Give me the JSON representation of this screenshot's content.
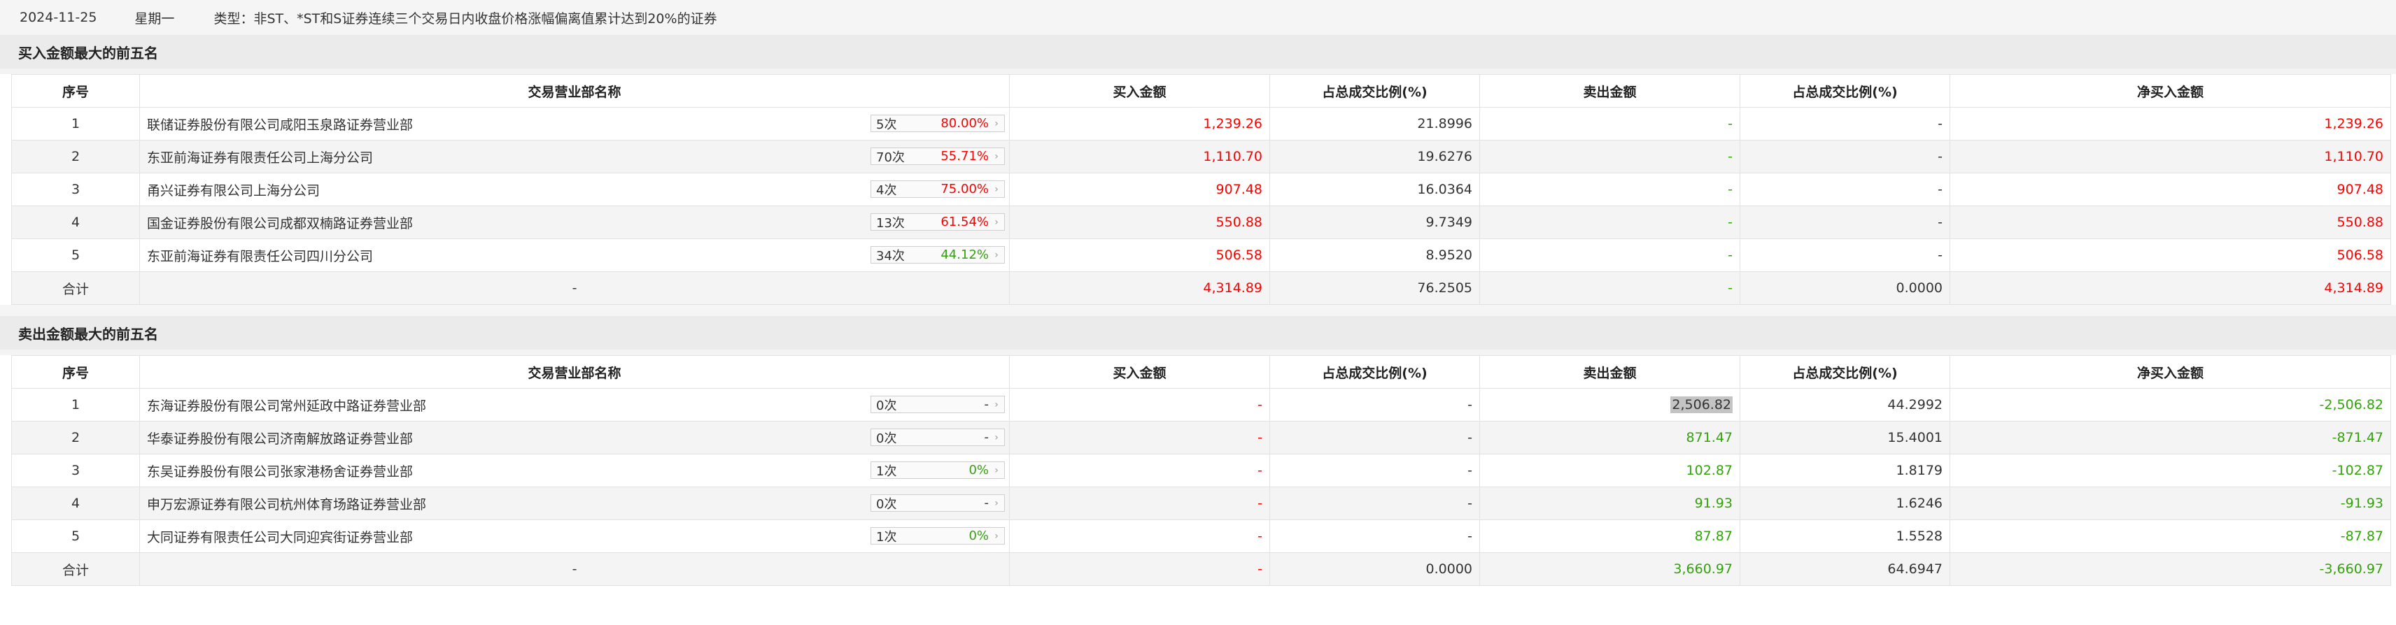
{
  "header": {
    "date": "2024-11-25",
    "weekday": "星期一",
    "type_text": "类型：非ST、*ST和S证券连续三个交易日内收盘价格涨幅偏离值累计达到20%的证券"
  },
  "columns": [
    "序号",
    "交易营业部名称",
    "买入金额",
    "占总成交比例(%)",
    "卖出金额",
    "占总成交比例(%)",
    "净买入金额"
  ],
  "colors": {
    "up": "#ff0000",
    "down": "#33a30b"
  },
  "buy_section": {
    "title": "买入金额最大的前五名",
    "rows": [
      {
        "idx": "1",
        "name": "联储证券股份有限公司咸阳玉泉路证券营业部",
        "count": "5次",
        "rate": "80.00%",
        "buy": "1,239.26",
        "buy_pct": "21.8996",
        "sell": "-",
        "sell_pct": "-",
        "net": "1,239.26"
      },
      {
        "idx": "2",
        "name": "东亚前海证券有限责任公司上海分公司",
        "count": "70次",
        "rate": "55.71%",
        "buy": "1,110.70",
        "buy_pct": "19.6276",
        "sell": "-",
        "sell_pct": "-",
        "net": "1,110.70"
      },
      {
        "idx": "3",
        "name": "甬兴证券有限公司上海分公司",
        "count": "4次",
        "rate": "75.00%",
        "buy": "907.48",
        "buy_pct": "16.0364",
        "sell": "-",
        "sell_pct": "-",
        "net": "907.48"
      },
      {
        "idx": "4",
        "name": "国金证券股份有限公司成都双楠路证券营业部",
        "count": "13次",
        "rate": "61.54%",
        "buy": "550.88",
        "buy_pct": "9.7349",
        "sell": "-",
        "sell_pct": "-",
        "net": "550.88"
      },
      {
        "idx": "5",
        "name": "东亚前海证券有限责任公司四川分公司",
        "count": "34次",
        "rate": "44.12%",
        "buy": "506.58",
        "buy_pct": "8.9520",
        "sell": "-",
        "sell_pct": "-",
        "net": "506.58"
      }
    ],
    "total": {
      "label": "合计",
      "name": "-",
      "buy": "4,314.89",
      "buy_pct": "76.2505",
      "sell": "-",
      "sell_pct": "0.0000",
      "net": "4,314.89"
    }
  },
  "sell_section": {
    "title": "卖出金额最大的前五名",
    "rows": [
      {
        "idx": "1",
        "name": "东海证券股份有限公司常州延政中路证券营业部",
        "count": "0次",
        "rate": "-",
        "buy": "-",
        "buy_pct": "-",
        "sell": "2,506.82",
        "sell_pct": "44.2992",
        "net": "-2,506.82"
      },
      {
        "idx": "2",
        "name": "华泰证券股份有限公司济南解放路证券营业部",
        "count": "0次",
        "rate": "-",
        "buy": "-",
        "buy_pct": "-",
        "sell": "871.47",
        "sell_pct": "15.4001",
        "net": "-871.47"
      },
      {
        "idx": "3",
        "name": "东吴证券股份有限公司张家港杨舍证券营业部",
        "count": "1次",
        "rate": "0%",
        "buy": "-",
        "buy_pct": "-",
        "sell": "102.87",
        "sell_pct": "1.8179",
        "net": "-102.87"
      },
      {
        "idx": "4",
        "name": "申万宏源证券有限公司杭州体育场路证券营业部",
        "count": "0次",
        "rate": "-",
        "buy": "-",
        "buy_pct": "-",
        "sell": "91.93",
        "sell_pct": "1.6246",
        "net": "-91.93"
      },
      {
        "idx": "5",
        "name": "大同证券有限责任公司大同迎宾街证券营业部",
        "count": "1次",
        "rate": "0%",
        "buy": "-",
        "buy_pct": "-",
        "sell": "87.87",
        "sell_pct": "1.5528",
        "net": "-87.87"
      }
    ],
    "total": {
      "label": "合计",
      "name": "-",
      "buy": "-",
      "buy_pct": "0.0000",
      "sell": "3,660.97",
      "sell_pct": "64.6947",
      "net": "-3,660.97"
    }
  }
}
